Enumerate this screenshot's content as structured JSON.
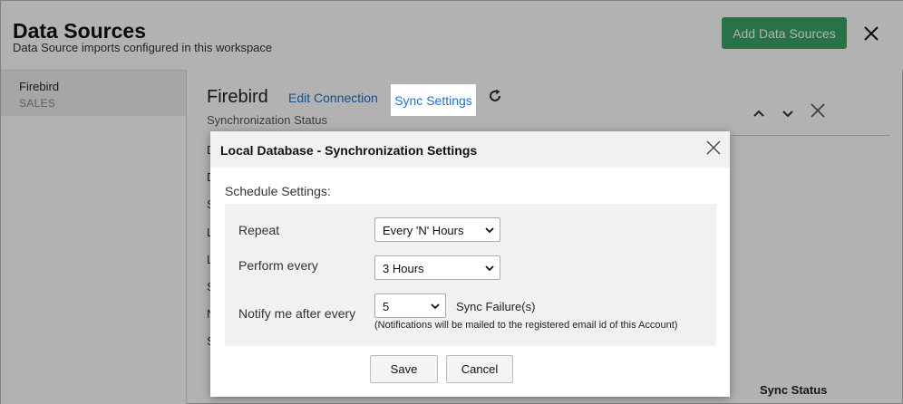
{
  "header": {
    "title": "Data Sources",
    "subtitle": "Data Source imports configured in this workspace",
    "add_button": "Add Data Sources"
  },
  "sidebar": {
    "items": [
      {
        "name": "Firebird",
        "sub": "SALES"
      }
    ]
  },
  "content": {
    "datasource_name": "Firebird",
    "edit_connection": "Edit Connection",
    "sync_settings": "Sync Settings",
    "sync_status_label": "Synchronization Status",
    "row_initials": [
      "D",
      "D",
      "S",
      "L",
      "L",
      "S",
      "N",
      "S"
    ],
    "sync_status_column": "Sync Status"
  },
  "modal": {
    "title": "Local Database - Synchronization Settings",
    "schedule_label": "Schedule Settings:",
    "repeat_label": "Repeat",
    "repeat_value": "Every 'N' Hours",
    "perform_label": "Perform every",
    "perform_value": "3 Hours",
    "notify_label": "Notify me after every",
    "notify_value": "5",
    "sync_failure": "Sync Failure(s)",
    "notify_note": "(Notifications will be mailed to the registered email id of this Account)",
    "save": "Save",
    "cancel": "Cancel"
  },
  "colors": {
    "accent_green": "#3aa466",
    "link_blue": "#1f6fd0"
  }
}
